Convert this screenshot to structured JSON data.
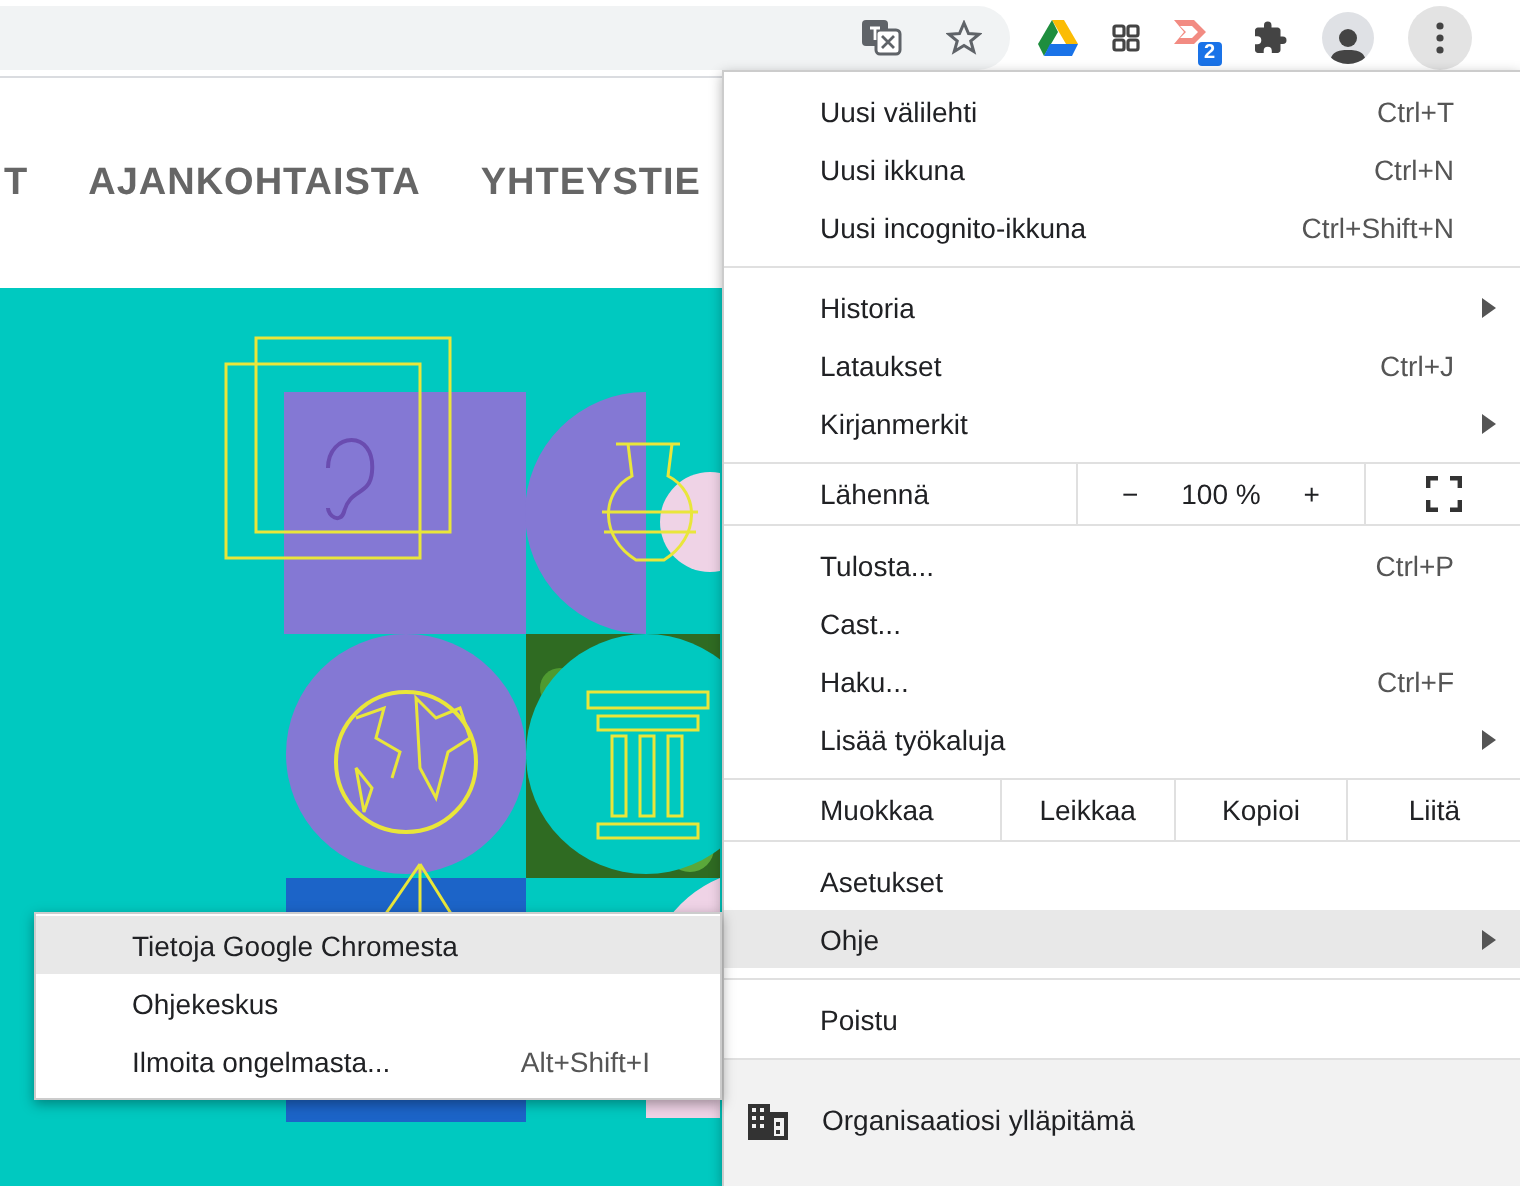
{
  "toolbar": {
    "extension_badge": "2"
  },
  "nav": [
    "T",
    "AJANKOHTAISTA",
    "YHTEYSTIE"
  ],
  "menu": {
    "sections": [
      [
        {
          "kind": "item",
          "label": "Uusi välilehti",
          "shortcut": "Ctrl+T",
          "submenu": false,
          "selected": false
        },
        {
          "kind": "item",
          "label": "Uusi ikkuna",
          "shortcut": "Ctrl+N",
          "submenu": false,
          "selected": false
        },
        {
          "kind": "item",
          "label": "Uusi incognito-ikkuna",
          "shortcut": "Ctrl+Shift+N",
          "submenu": false,
          "selected": false
        }
      ],
      [
        {
          "kind": "item",
          "label": "Historia",
          "submenu": true,
          "selected": false
        },
        {
          "kind": "item",
          "label": "Lataukset",
          "shortcut": "Ctrl+J",
          "submenu": false,
          "selected": false
        },
        {
          "kind": "item",
          "label": "Kirjanmerkit",
          "submenu": true,
          "selected": false
        }
      ],
      [
        {
          "kind": "zoom",
          "label": "Lähennä",
          "zoom_out": "−",
          "zoom_value": "100 %",
          "zoom_in": "+"
        }
      ],
      [
        {
          "kind": "item",
          "label": "Tulosta...",
          "shortcut": "Ctrl+P",
          "submenu": false,
          "selected": false
        },
        {
          "kind": "item",
          "label": "Cast...",
          "submenu": false,
          "selected": false
        },
        {
          "kind": "item",
          "label": "Haku...",
          "shortcut": "Ctrl+F",
          "submenu": false,
          "selected": false
        },
        {
          "kind": "item",
          "label": "Lisää työkaluja",
          "submenu": true,
          "selected": false
        }
      ],
      [
        {
          "kind": "edit",
          "label": "Muokkaa",
          "actions": [
            "Leikkaa",
            "Kopioi",
            "Liitä"
          ]
        }
      ],
      [
        {
          "kind": "item",
          "label": "Asetukset",
          "submenu": false,
          "selected": false
        },
        {
          "kind": "item",
          "label": "Ohje",
          "submenu": true,
          "selected": true
        }
      ],
      [
        {
          "kind": "item",
          "label": "Poistu",
          "submenu": false,
          "selected": false
        }
      ],
      [
        {
          "kind": "managed",
          "label": "Organisaatiosi ylläpitämä"
        }
      ]
    ]
  },
  "submenu": {
    "items": [
      {
        "label": "Tietoja Google Chromesta",
        "selected": true
      },
      {
        "label": "Ohjekeskus",
        "selected": false
      },
      {
        "label": "Ilmoita ongelmasta...",
        "shortcut": "Alt+Shift+I",
        "selected": false
      }
    ]
  }
}
